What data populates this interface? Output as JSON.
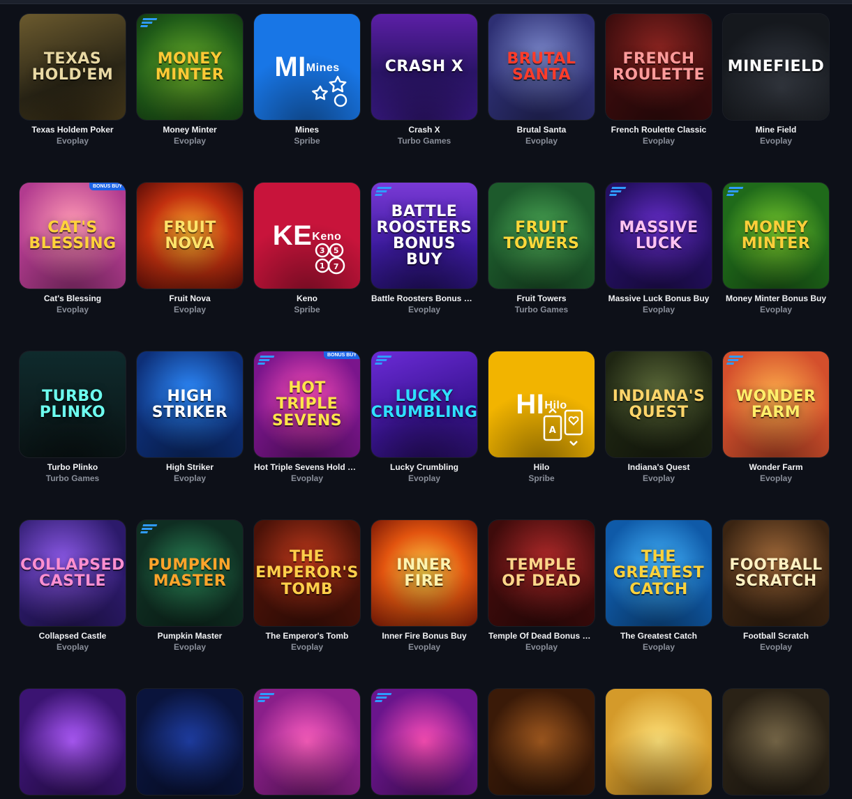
{
  "games": [
    {
      "title": "Texas Holdem Poker",
      "provider": "Evoplay",
      "art": "TEXAS HOLD'EM",
      "bg": "linear-gradient(160deg,#6b5a2e,#2b2616 60%,#4a3c1c)",
      "fg": "#e9d9a4",
      "icon": "texas-holdem-art-icon",
      "badge": false
    },
    {
      "title": "Money Minter",
      "provider": "Evoplay",
      "art": "MONEY MINTER",
      "bg": "radial-gradient(circle at 50% 55%,#6fb52b,#1f5b18 70%,#123812)",
      "fg": "#ffc935",
      "icon": "money-minter-art-icon",
      "badge": true
    },
    {
      "title": "Mines",
      "provider": "Spribe",
      "art": "Mi",
      "sub": "Mines",
      "bg": "#1876e6",
      "fg": "#ffffff",
      "icon": "mines-stars-icon",
      "badge": false,
      "spribe": "stars"
    },
    {
      "title": "Crash X",
      "provider": "Turbo Games",
      "art": "CRASH X",
      "bg": "linear-gradient(180deg,#5c1fa6,#2a1466 55%,#3b1a8a)",
      "fg": "#ffffff",
      "icon": "rocket-icon",
      "badge": false
    },
    {
      "title": "Brutal Santa",
      "provider": "Evoplay",
      "art": "BRUTAL SANTA",
      "bg": "radial-gradient(circle at 50% 40%,#7a86c9,#2d2f73 70%)",
      "fg": "#ff3c2a",
      "icon": "santa-art-icon",
      "badge": false
    },
    {
      "title": "French Roulette Classic",
      "provider": "Evoplay",
      "art": "FRENCH ROULETTE",
      "bg": "radial-gradient(circle at 50% 35%,#8a2420,#3a0c0d 70%)",
      "fg": "#ff9b9b",
      "icon": "roulette-wheel-icon",
      "badge": false
    },
    {
      "title": "Mine Field",
      "provider": "Evoplay",
      "art": "MINEFIELD",
      "bg": "radial-gradient(circle at 55% 70%,#3a3f48,#15181d 70%)",
      "fg": "#ffffff",
      "icon": "minefield-art-icon",
      "badge": false
    },
    {
      "title": "Cat's Blessing",
      "provider": "Evoplay",
      "art": "CAT'S BLESSING",
      "bg": "radial-gradient(circle at 50% 40%,#ff9ab4,#b23b8f 70%)",
      "fg": "#ffd23b",
      "icon": "lucky-cat-icon",
      "badge": false,
      "tag": "BONUS BUY"
    },
    {
      "title": "Fruit Nova",
      "provider": "Evoplay",
      "art": "FRUIT NOVA",
      "bg": "radial-gradient(circle at 50% 50%,#ffb530,#c2300f 55%,#5c0d08)",
      "fg": "#ffe36a",
      "icon": "fruit-nova-art-icon",
      "badge": false
    },
    {
      "title": "Keno",
      "provider": "Spribe",
      "art": "Ke",
      "sub": "Keno",
      "bg": "#c8143b",
      "fg": "#ffffff",
      "icon": "keno-balls-icon",
      "badge": false,
      "spribe": "keno"
    },
    {
      "title": "Battle Roosters Bonus Buy",
      "provider": "Evoplay",
      "art": "BATTLE ROOSTERS BONUS BUY",
      "bg": "linear-gradient(180deg,#7a3ad6,#3d1ba0 60%,#2a137a)",
      "fg": "#ffffff",
      "icon": "rooster-art-icon",
      "badge": true
    },
    {
      "title": "Fruit Towers",
      "provider": "Turbo Games",
      "art": "FRUIT TOWERS",
      "bg": "radial-gradient(circle at 50% 50%,#4fae58,#1d5a2c 70%)",
      "fg": "#ffd83a",
      "icon": "fruit-towers-art-icon",
      "badge": false
    },
    {
      "title": "Massive Luck Bonus Buy",
      "provider": "Evoplay",
      "art": "MASSIVE LUCK",
      "bg": "radial-gradient(circle at 50% 45%,#6a2fd0,#251063 70%)",
      "fg": "#ffc3f2",
      "icon": "massive-luck-art-icon",
      "badge": true
    },
    {
      "title": "Money Minter Bonus Buy",
      "provider": "Evoplay",
      "art": "MONEY MINTER",
      "bg": "radial-gradient(circle at 50% 50%,#7ccf2e,#1f6a1a 70%)",
      "fg": "#ffcf3a",
      "icon": "money-minter-bonus-art-icon",
      "badge": true
    },
    {
      "title": "Turbo Plinko",
      "provider": "Turbo Games",
      "art": "TURBO PLINKO",
      "bg": "linear-gradient(180deg,#0f2a2c,#0a1516)",
      "fg": "#6dfff0",
      "icon": "plinko-art-icon",
      "badge": false
    },
    {
      "title": "High Striker",
      "provider": "Evoplay",
      "art": "HIGH STRIKER",
      "bg": "radial-gradient(circle at 50% 40%,#2e8cff,#0d2f78 70%)",
      "fg": "#ffffff",
      "icon": "high-striker-art-icon",
      "badge": false
    },
    {
      "title": "Hot Triple Sevens Hold and Win",
      "provider": "Evoplay",
      "art": "HOT TRIPLE SEVENS",
      "bg": "radial-gradient(circle at 50% 45%,#ff4fb8,#7a158c 70%)",
      "fg": "#ffe54a",
      "icon": "sevens-art-icon",
      "badge": true,
      "tag": "BONUS BUY"
    },
    {
      "title": "Lucky Crumbling",
      "provider": "Evoplay",
      "art": "LUCKY CRUMBLING",
      "bg": "linear-gradient(160deg,#6b2bd6,#3a1493 60%,#2b0f6e)",
      "fg": "#2fe0ff",
      "icon": "lucky-crumbling-art-icon",
      "badge": true
    },
    {
      "title": "Hilo",
      "provider": "Spribe",
      "art": "Hi",
      "sub": "Hilo",
      "bg": "#f2b400",
      "fg": "#ffffff",
      "icon": "playing-cards-icon",
      "badge": false,
      "spribe": "cards"
    },
    {
      "title": "Indiana's Quest",
      "provider": "Evoplay",
      "art": "INDIANA'S QUEST",
      "bg": "radial-gradient(circle at 50% 40%,#5d6b3a,#1e2512 70%)",
      "fg": "#ffd56a",
      "icon": "explorer-art-icon",
      "badge": false
    },
    {
      "title": "Wonder Farm",
      "provider": "Evoplay",
      "art": "WONDER FARM",
      "bg": "radial-gradient(circle at 50% 45%,#ffb24d,#d44f2c 70%)",
      "fg": "#ffef6a",
      "icon": "farm-art-icon",
      "badge": true
    },
    {
      "title": "Collapsed Castle",
      "provider": "Evoplay",
      "art": "COLLAPSED CASTLE",
      "bg": "radial-gradient(circle at 40% 40%,#8d5ae8,#2c1a6b 70%)",
      "fg": "#ff8fd0",
      "icon": "castle-art-icon",
      "badge": false
    },
    {
      "title": "Pumpkin Master",
      "provider": "Evoplay",
      "art": "PUMPKIN MASTER",
      "bg": "radial-gradient(circle at 50% 50%,#2c8a5a,#0f2e22 70%)",
      "fg": "#ffa42b",
      "icon": "pumpkin-art-icon",
      "badge": true
    },
    {
      "title": "The Emperor's Tomb",
      "provider": "Evoplay",
      "art": "THE EMPEROR'S TOMB",
      "bg": "radial-gradient(circle at 50% 40%,#c23a1c,#4a1208 70%)",
      "fg": "#ffcf4a",
      "icon": "emperor-art-icon",
      "badge": false
    },
    {
      "title": "Inner Fire Bonus Buy",
      "provider": "Evoplay",
      "art": "INNER FIRE",
      "bg": "radial-gradient(circle at 50% 50%,#ffd34a,#e2540f 55%,#7a1806)",
      "fg": "#fff4b0",
      "icon": "inner-fire-art-icon",
      "badge": false
    },
    {
      "title": "Temple Of Dead Bonus Buy",
      "provider": "Evoplay",
      "art": "TEMPLE OF DEAD",
      "bg": "radial-gradient(circle at 55% 40%,#b22a2a,#3e0b0b 70%)",
      "fg": "#ffd68a",
      "icon": "temple-art-icon",
      "badge": false
    },
    {
      "title": "The Greatest Catch",
      "provider": "Evoplay",
      "art": "THE GREATEST CATCH",
      "bg": "radial-gradient(circle at 50% 45%,#46b7ff,#0f5aa8 70%)",
      "fg": "#ffd23b",
      "icon": "fisherman-art-icon",
      "badge": false
    },
    {
      "title": "Football Scratch",
      "provider": "Evoplay",
      "art": "FOOTBALL SCRATCH",
      "bg": "radial-gradient(circle at 50% 40%,#a26a3a,#3a2412 70%)",
      "fg": "#fff1c2",
      "icon": "football-art-icon",
      "badge": false
    },
    {
      "title": "",
      "provider": "",
      "art": "",
      "bg": "radial-gradient(circle at 50% 50%,#b05cff,#3b1472 70%)",
      "fg": "#ffd23b",
      "icon": "mandala-art-icon",
      "badge": false
    },
    {
      "title": "",
      "provider": "",
      "art": "",
      "bg": "radial-gradient(circle at 50% 50%,#1f3fa8,#0a143c 70%)",
      "fg": "#ffffff",
      "icon": "night-sky-art-icon",
      "badge": false
    },
    {
      "title": "",
      "provider": "",
      "art": "",
      "bg": "radial-gradient(circle at 50% 50%,#ff5fc0,#8a1f8a 70%)",
      "fg": "#ffe54a",
      "icon": "buddha-art-icon",
      "badge": true
    },
    {
      "title": "",
      "provider": "",
      "art": "",
      "bg": "radial-gradient(circle at 50% 50%,#ff4fb8,#6a158c 70%)",
      "fg": "#ffe54a",
      "icon": "sevens-art-icon",
      "badge": true
    },
    {
      "title": "",
      "provider": "",
      "art": "",
      "bg": "radial-gradient(circle at 50% 50%,#a35a1f,#3a1a08 70%)",
      "fg": "#ffd68a",
      "icon": "anubis-art-icon",
      "badge": false
    },
    {
      "title": "",
      "provider": "",
      "art": "",
      "bg": "radial-gradient(circle at 50% 50%,#ffe27a,#d49a2a 70%)",
      "fg": "#ffffff",
      "icon": "golden-statue-art-icon",
      "badge": false
    },
    {
      "title": "",
      "provider": "",
      "art": "",
      "bg": "radial-gradient(circle at 50% 50%,#7a6a4a,#2a2216 70%)",
      "fg": "#ffd68a",
      "icon": "adventure-art-icon",
      "badge": false
    }
  ]
}
